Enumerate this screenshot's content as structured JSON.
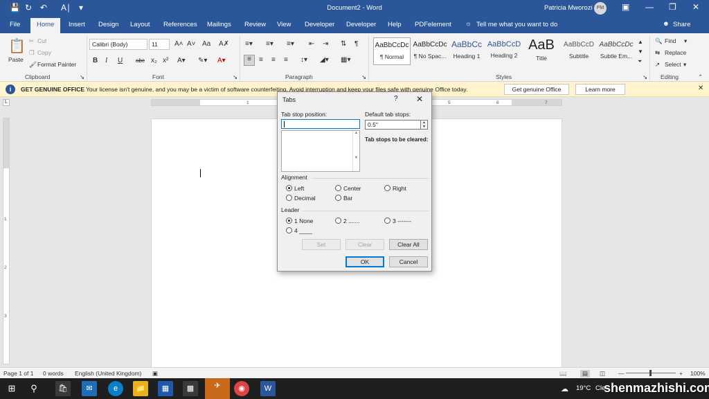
{
  "window": {
    "doc_title": "Document2  -  Word",
    "user_name": "Patricia Mworozi",
    "user_initials": "PM"
  },
  "tabs": [
    "File",
    "Home",
    "Insert",
    "Design",
    "Layout",
    "References",
    "Mailings",
    "Review",
    "View",
    "Developer",
    "Developer",
    "Help",
    "PDFelement"
  ],
  "tell_me": "Tell me what you want to do",
  "share": "Share",
  "ribbon": {
    "clipboard": {
      "paste": "Paste",
      "cut": "Cut",
      "copy": "Copy",
      "format_painter": "Format Painter",
      "label": "Clipboard"
    },
    "font": {
      "name": "Calibri (Body)",
      "size": "11",
      "label": "Font"
    },
    "paragraph": {
      "label": "Paragraph"
    },
    "styles": {
      "label": "Styles",
      "items": [
        {
          "sample": "AaBbCcDc",
          "name": "¶ Normal"
        },
        {
          "sample": "AaBbCcDc",
          "name": "¶ No Spac..."
        },
        {
          "sample": "AaBbCc",
          "name": "Heading 1"
        },
        {
          "sample": "AaBbCcD",
          "name": "Heading 2"
        },
        {
          "sample": "AaB",
          "name": "Title"
        },
        {
          "sample": "AaBbCcD",
          "name": "Subtitle"
        },
        {
          "sample": "AaBbCcDc",
          "name": "Subtle Em..."
        }
      ]
    },
    "editing": {
      "find": "Find",
      "replace": "Replace",
      "select": "Select",
      "label": "Editing"
    }
  },
  "notice": {
    "heading": "GET GENUINE OFFICE",
    "message": "Your license isn't genuine, and you may be a victim of software counterfeiting. Avoid interruption and keep your files safe with genuine Office today.",
    "button_primary": "Get genuine Office",
    "button_secondary": "Learn more"
  },
  "ruler_numbers": [
    "1",
    "2",
    "3",
    "4",
    "5",
    "6",
    "7"
  ],
  "vruler_numbers": [
    "1",
    "2",
    "3"
  ],
  "dialog": {
    "title": "Tabs",
    "help": "?",
    "close": "✕",
    "tab_stop_position_label": "Tab stop position:",
    "tab_stop_position_value": "",
    "default_tab_stops_label": "Default tab stops:",
    "default_tab_stops_value": "0.5\"",
    "to_be_cleared_label": "Tab stops to be cleared:",
    "alignment_label": "Alignment",
    "alignment_options": [
      "Left",
      "Center",
      "Right",
      "Decimal",
      "Bar"
    ],
    "alignment_selected": "Left",
    "leader_label": "Leader",
    "leader_options": [
      "1 None",
      "2 .......",
      "3 -------",
      "4 ____"
    ],
    "leader_selected": "1 None",
    "buttons": {
      "set": "Set",
      "clear": "Clear",
      "clear_all": "Clear All",
      "ok": "OK",
      "cancel": "Cancel"
    }
  },
  "status": {
    "page": "Page 1 of 1",
    "words": "0 words",
    "language": "English (United Kingdom)",
    "zoom": "100%"
  },
  "taskbar": {
    "weather": "19°C",
    "weather_partial": "Cle",
    "watermark": "shenmazhishi.com"
  },
  "colors": {
    "word_blue": "#2b579a",
    "notice_yellow": "#fff4ce",
    "taskbar": "#1f1f1f"
  }
}
